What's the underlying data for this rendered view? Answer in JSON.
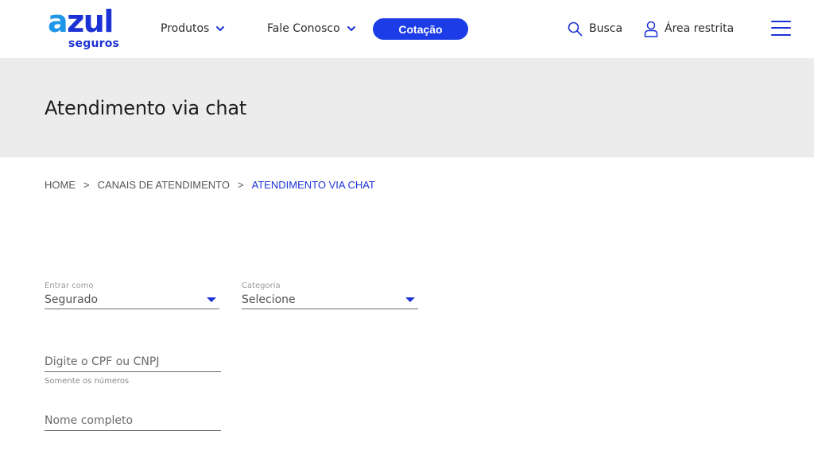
{
  "brand": {
    "logo_main": "azul",
    "logo_sub": "seguros",
    "primary_color": "#1c32d4",
    "accent_color": "#1f96e8",
    "button_color": "#1b3ce6"
  },
  "header": {
    "nav": [
      {
        "label": "Produtos",
        "icon": "chevron-down-icon"
      },
      {
        "label": "Fale Conosco",
        "icon": "chevron-down-icon"
      }
    ],
    "cta_label": "Cotação",
    "search_label": "Busca",
    "search_icon": "search-icon",
    "restricted_label": "Área restrita",
    "restricted_icon": "user-icon",
    "menu_icon": "hamburger-menu-icon"
  },
  "hero": {
    "title": "Atendimento via chat"
  },
  "breadcrumb": {
    "items": [
      "HOME",
      "CANAIS DE ATENDIMENTO",
      "ATENDIMENTO VIA CHAT"
    ],
    "separator": ">"
  },
  "form": {
    "entrar_como": {
      "label": "Entrar como",
      "value": "Segurado"
    },
    "categoria": {
      "label": "Categoria",
      "value": "Selecione"
    },
    "cpf": {
      "placeholder": "Digite o CPF ou CNPJ",
      "hint": "Somente os números"
    },
    "nome": {
      "placeholder": "Nome completo"
    }
  }
}
